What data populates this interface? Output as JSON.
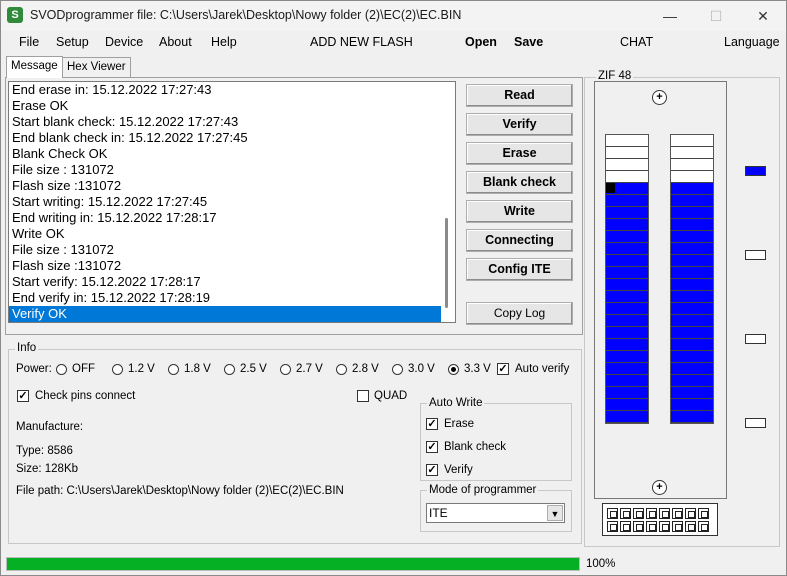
{
  "window": {
    "title": "SVODprogrammer file: C:\\Users\\Jarek\\Desktop\\Nowy folder (2)\\EC(2)\\EC.BIN",
    "icon_letter": "S",
    "minimize_glyph": "—",
    "maximize_glyph": "☐",
    "close_glyph": "✕"
  },
  "menu": {
    "file": "File",
    "setup": "Setup",
    "device": "Device",
    "about": "About",
    "help": "Help",
    "add_flash": "ADD NEW FLASH",
    "open": "Open",
    "save": "Save",
    "chat": "CHAT",
    "language": "Language"
  },
  "tabs": [
    "Message",
    "Hex Viewer"
  ],
  "log": [
    "End erase in: 15.12.2022 17:27:43",
    "Erase OK",
    "Start blank check: 15.12.2022 17:27:43",
    "End blank check in: 15.12.2022 17:27:45",
    "Blank Check OK",
    "File size : 131072",
    "Flash size :131072",
    "Start writing: 15.12.2022 17:27:45",
    "End writing in: 15.12.2022 17:28:17",
    "Write OK",
    "File size : 131072",
    "Flash size :131072",
    "Start verify: 15.12.2022 17:28:17",
    "End verify in: 15.12.2022 17:28:19",
    "Verify OK"
  ],
  "selected_log_index": 14,
  "buttons": {
    "read": "Read",
    "verify": "Verify",
    "erase": "Erase",
    "blank_check": "Blank check",
    "write": "Write",
    "connecting": "Connecting",
    "config_ite": "Config ITE",
    "copy_log": "Copy Log"
  },
  "info": {
    "group_label": "Info",
    "power_label": "Power:",
    "power_options": [
      "OFF",
      "1.2 V",
      "1.8 V",
      "2.5 V",
      "2.7 V",
      "2.8 V",
      "3.0 V",
      "3.3 V"
    ],
    "power_selected": "3.3 V",
    "auto_verify_label": "Auto verify",
    "auto_verify_checked": true,
    "check_pins_label": "Check pins connect",
    "check_pins_checked": true,
    "quad_label": "QUAD",
    "quad_checked": false,
    "manufacture": "Manufacture:",
    "type": "Type: 8586",
    "size": "Size: 128Kb",
    "file_path": "File path: C:\\Users\\Jarek\\Desktop\\Nowy folder (2)\\EC(2)\\EC.BIN"
  },
  "auto_write": {
    "label": "Auto Write",
    "erase": "Erase",
    "blank_check": "Blank check",
    "verify": "Verify",
    "erase_checked": true,
    "blank_check_checked": true,
    "verify_checked": true
  },
  "mode": {
    "label": "Mode of programmer",
    "value": "ITE",
    "arrow_glyph": "▼"
  },
  "progress": {
    "value": 100,
    "text": "100%",
    "color": "#06b025"
  },
  "zif": {
    "label": "ZIF 48",
    "pins_per_side": 24,
    "inactive_top_pins": 4,
    "marker_pin_index": 4,
    "active_color": "#0000ff",
    "screw_glyph": "+",
    "side_indicators_active": [
      true,
      false,
      false,
      false
    ]
  }
}
